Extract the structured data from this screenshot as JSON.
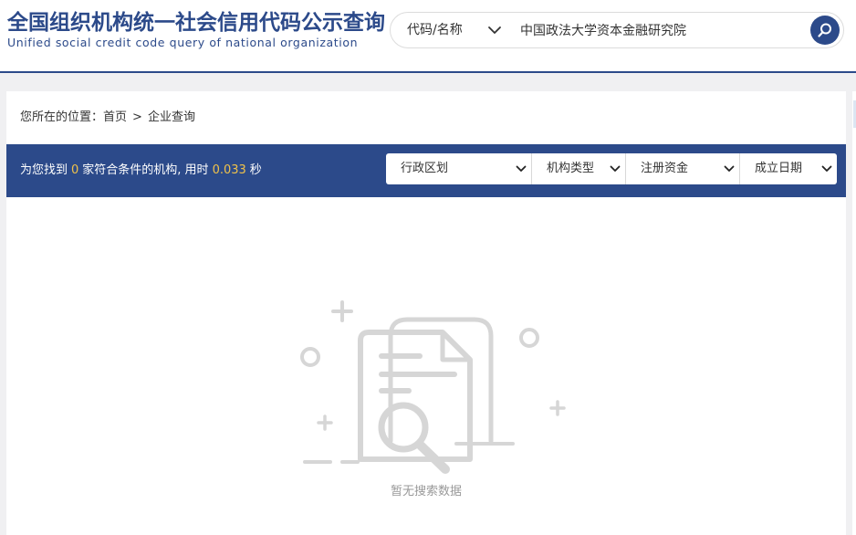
{
  "header": {
    "title": "全国组织机构统一社会信用代码公示查询",
    "subtitle": "Unified social credit code query of national organization"
  },
  "search": {
    "type_label": "代码/名称",
    "query": "中国政法大学资本金融研究院"
  },
  "breadcrumb": {
    "prefix": "您所在的位置：",
    "home": "首页",
    "separator": ">",
    "current": "企业查询"
  },
  "result": {
    "text_before": "为您找到",
    "count": "0",
    "text_middle": "家符合条件的机构, 用时",
    "time": "0.033",
    "text_after": "秒"
  },
  "filters": [
    {
      "label": "行政区划"
    },
    {
      "label": "机构类型"
    },
    {
      "label": "注册资金"
    },
    {
      "label": "成立日期"
    }
  ],
  "empty": {
    "message": "暂无搜索数据"
  },
  "colors": {
    "brand": "#2c4a8a",
    "highlight": "#f0c24a",
    "illustration": "#d6d6d6",
    "muted_text": "#999999"
  },
  "icons": {
    "search": "search-icon",
    "chevron": "chevron-down-icon",
    "empty": "empty-document-icon"
  }
}
